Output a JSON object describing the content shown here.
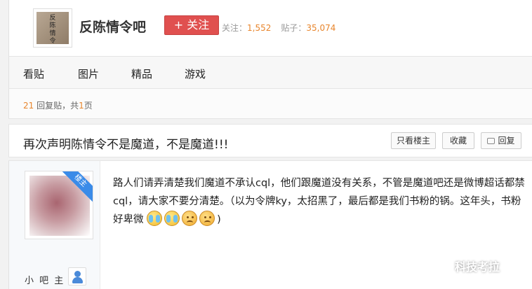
{
  "forum": {
    "avatar_text": "反陈情令",
    "name": "反陈情令吧",
    "follow_label": "+ 关注",
    "followers_label": "关注：",
    "followers_count": "1,552",
    "posts_label": "贴子：",
    "posts_count": "35,074"
  },
  "nav": {
    "items": [
      {
        "label": "看贴"
      },
      {
        "label": "图片"
      },
      {
        "label": "精品"
      },
      {
        "label": "游戏"
      }
    ]
  },
  "pager": {
    "reply_count": "21",
    "reply_text": " 回复贴，共",
    "page_count": "1",
    "page_text": "页"
  },
  "thread": {
    "title": "再次声明陈情令不是魔道，不是魔道!!!",
    "only_op_label": "只看楼主",
    "favorite_label": "收藏",
    "reply_label": "回复"
  },
  "post": {
    "badge": "楼主",
    "author_name": "小 吧 主",
    "content_main": "路人们请弄清楚我们魔道不承认cql，他们跟魔道没有关系，不管是魔道吧还是微博超话都禁cql，请大家不要分清楚。（以为令牌ky，太招黑了，最后都是我们书粉的锅。这年头，书粉好卑微",
    "content_end": ")",
    "emojis": [
      "cry-emoji",
      "cry-emoji",
      "sad-emoji",
      "sad-emoji"
    ]
  },
  "watermark": {
    "text": "科技考拉"
  }
}
